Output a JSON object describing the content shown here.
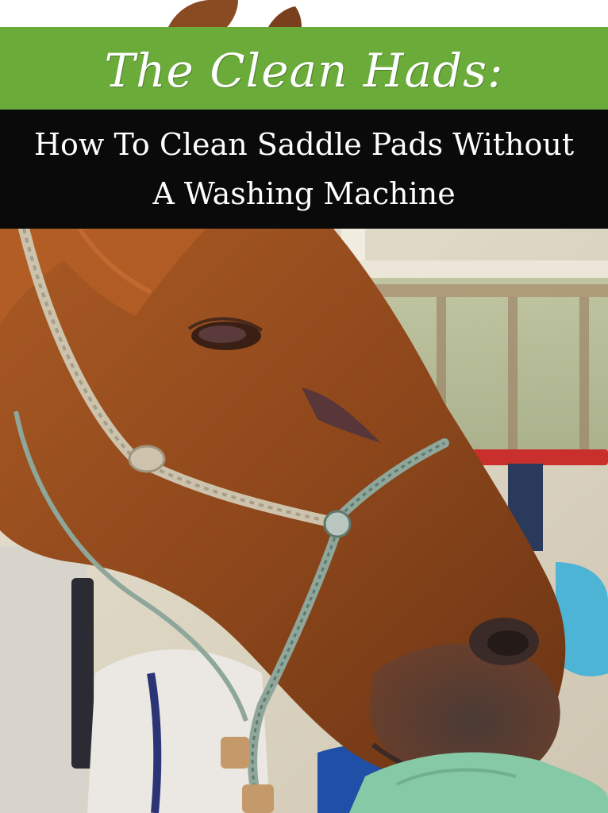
{
  "header": {
    "title": "The Clean Hads:",
    "subtitle_line1": "How To Clean Saddle Pads Without",
    "subtitle_line2": "A Washing Machine"
  },
  "colors": {
    "green_banner": "#6aab3a",
    "black_banner": "#0a0a0a",
    "horse_coat": "#9a4e1e",
    "halter_rope": "#c9bfa8",
    "cloth": "#86c9a6"
  },
  "image": {
    "subject_icon": "horse-photo"
  }
}
